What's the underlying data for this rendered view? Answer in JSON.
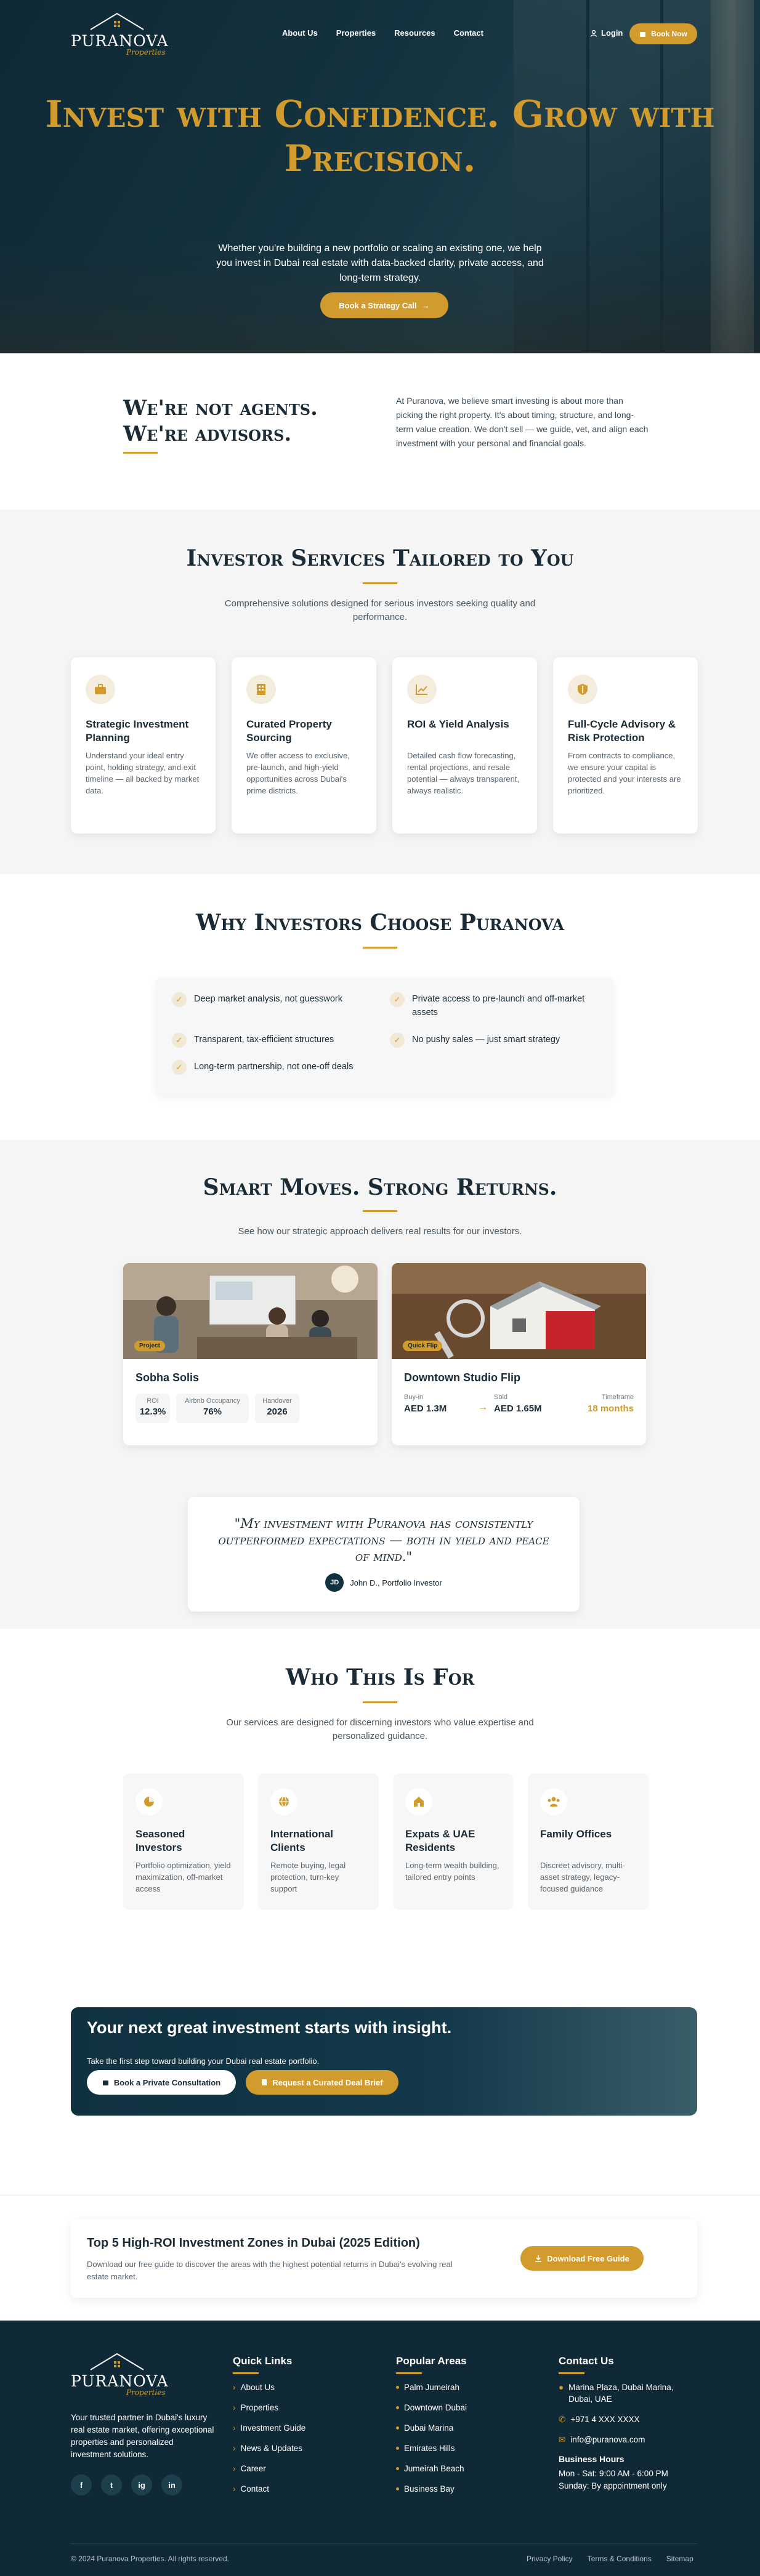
{
  "brand": {
    "name": "PURANOVA",
    "script": "Properties",
    "gold": "#d29b2d",
    "navy": "#0f2a36"
  },
  "nav": {
    "links": [
      "About Us",
      "Properties",
      "Resources",
      "Contact"
    ],
    "login": "Login",
    "book_now": "Book Now"
  },
  "hero": {
    "title": "Invest with Confidence. Grow with Precision.",
    "subtitle": "Whether you're building a new portfolio or scaling an existing one, we help you invest in Dubai real estate with data-backed clarity, private access, and long-term strategy.",
    "cta": "Book a Strategy Call"
  },
  "advisors": {
    "title_1": "We're not agents.",
    "title_2": "We're advisors.",
    "body": "At Puranova, we believe smart investing is about more than picking the right property. It's about timing, structure, and long-term value creation. We don't sell — we guide, vet, and align each investment with your personal and financial goals."
  },
  "services": {
    "title": "Investor Services Tailored to You",
    "subtitle": "Comprehensive solutions designed for serious investors seeking quality and performance.",
    "cards": [
      {
        "title": "Strategic Investment Planning",
        "body": "Understand your ideal entry point, holding strategy, and exit timeline — all backed by market data.",
        "icon": "briefcase-icon"
      },
      {
        "title": "Curated Property Sourcing",
        "body": "We offer access to exclusive, pre-launch, and high-yield opportunities across Dubai's prime districts.",
        "icon": "building-icon"
      },
      {
        "title": "ROI & Yield Analysis",
        "body": "Detailed cash flow forecasting, rental projections, and resale potential — always transparent, always realistic.",
        "icon": "chart-icon"
      },
      {
        "title": "Full-Cycle Advisory & Risk Protection",
        "body": "From contracts to compliance, we ensure your capital is protected and your interests are prioritized.",
        "icon": "shield-icon"
      }
    ]
  },
  "why": {
    "title": "Why Investors Choose Puranova",
    "items": [
      "Deep market analysis, not guesswork",
      "Private access to pre-launch and off-market assets",
      "Transparent, tax-efficient structures",
      "No pushy sales — just smart strategy",
      "Long-term partnership, not one-off deals"
    ]
  },
  "returns": {
    "title": "Smart Moves. Strong Returns.",
    "subtitle": "See how our strategic approach delivers real results for our investors.",
    "p1": {
      "tag": "Project",
      "name": "Sobha Solis",
      "stats": [
        {
          "label": "ROI",
          "value": "12.3%"
        },
        {
          "label": "Airbnb Occupancy",
          "value": "76%"
        },
        {
          "label": "Handover",
          "value": "2026"
        }
      ]
    },
    "p2": {
      "tag": "Quick Flip",
      "name": "Downtown Studio Flip",
      "buy_label": "Buy-in",
      "buy_value": "AED 1.3M",
      "sold_label": "Sold",
      "sold_value": "AED 1.65M",
      "time_label": "Timeframe",
      "time_value": "18 months"
    },
    "quote": "\"My investment with Puranova has consistently outperformed expectations — both in yield and peace of mind.\"",
    "initials": "JD",
    "author": "John D., Portfolio Investor"
  },
  "whofor": {
    "title": "Who This Is For",
    "subtitle": "Our services are designed for discerning investors who value expertise and personalized guidance.",
    "cards": [
      {
        "title": "Seasoned Investors",
        "body": "Portfolio optimization, yield maximization, off-market access",
        "icon": "pie-chart-icon"
      },
      {
        "title": "International Clients",
        "body": "Remote buying, legal protection, turn-key support",
        "icon": "globe-icon"
      },
      {
        "title": "Expats & UAE Residents",
        "body": "Long-term wealth building, tailored entry points",
        "icon": "home-icon"
      },
      {
        "title": "Family Offices",
        "body": "Discreet advisory, multi-asset strategy, legacy-focused guidance",
        "icon": "people-icon"
      }
    ]
  },
  "cta": {
    "title": "Your next great investment starts with insight.",
    "subtitle": "Take the first step toward building your Dubai real estate portfolio.",
    "btn1": "Book a Private Consultation",
    "btn2": "Request a Curated Deal Brief"
  },
  "guide": {
    "title": "Top 5 High-ROI Investment Zones in Dubai (2025 Edition)",
    "body": "Download our free guide to discover the areas with the highest potential returns in Dubai's evolving real estate market.",
    "btn": "Download Free Guide"
  },
  "footer": {
    "about": "Your trusted partner in Dubai's luxury real estate market, offering exceptional properties and personalized investment solutions.",
    "socials": [
      "f",
      "t",
      "ig",
      "in"
    ],
    "quick_title": "Quick Links",
    "quick": [
      "About Us",
      "Properties",
      "Investment Guide",
      "News & Updates",
      "Career",
      "Contact"
    ],
    "areas_title": "Popular Areas",
    "areas": [
      "Palm Jumeirah",
      "Downtown Dubai",
      "Dubai Marina",
      "Emirates Hills",
      "Jumeirah Beach",
      "Business Bay"
    ],
    "contact_title": "Contact Us",
    "address": "Marina Plaza, Dubai Marina, Dubai, UAE",
    "phone": "+971 4 XXX XXXX",
    "email": "info@puranova.com",
    "hours_title": "Business Hours",
    "hours_1": "Mon - Sat: 9:00 AM - 6:00 PM",
    "hours_2": "Sunday: By appointment only",
    "copyright": "© 2024 Puranova Properties. All rights reserved.",
    "legal": [
      "Privacy Policy",
      "Terms & Conditions",
      "Sitemap"
    ]
  }
}
